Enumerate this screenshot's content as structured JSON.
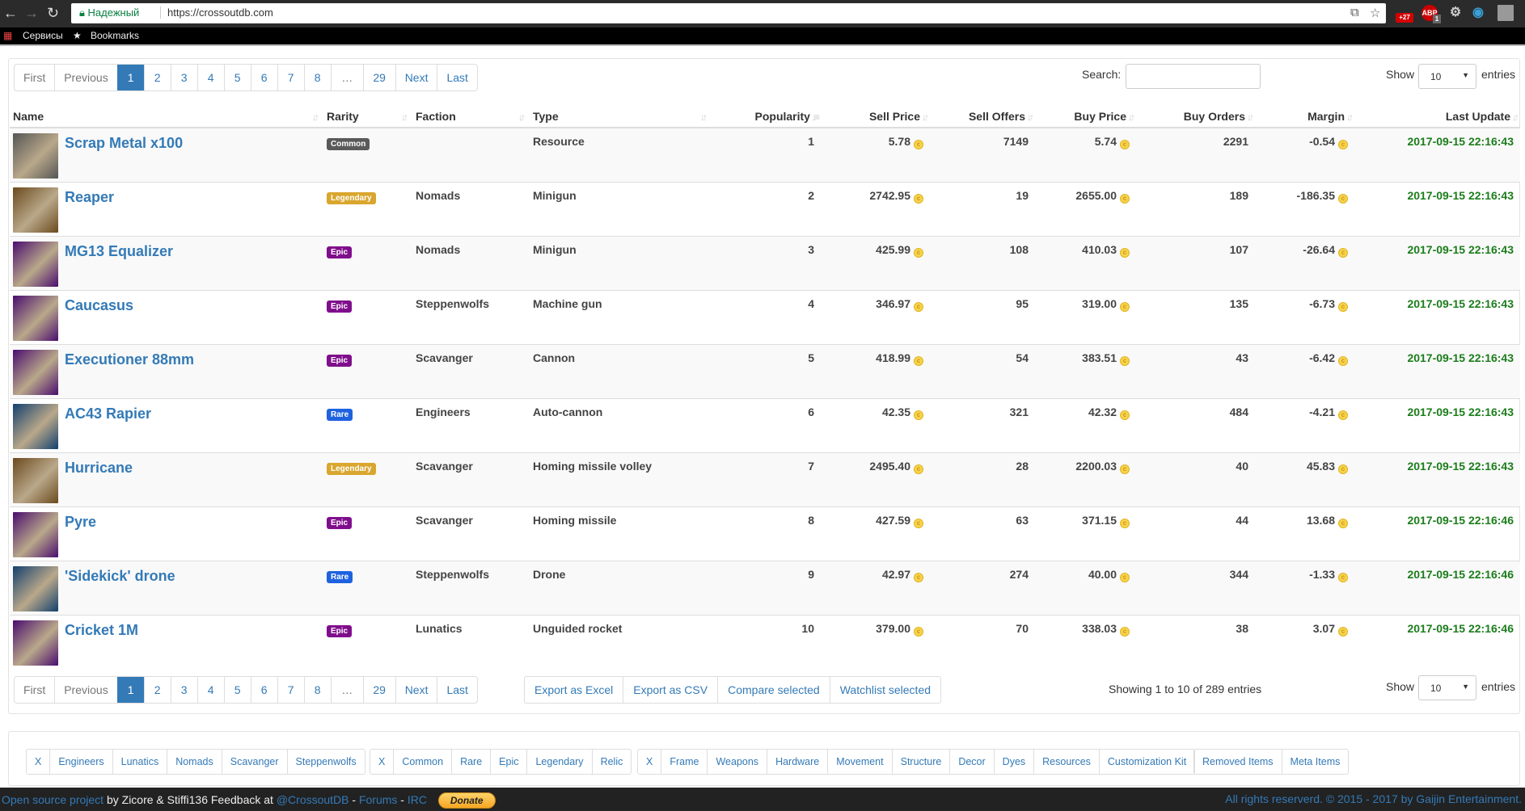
{
  "browser": {
    "secure_label": "Надежный",
    "url": "https://crossoutdb.com",
    "ext_badge": "+27",
    "abp_label": "ABP",
    "abp_count": "1",
    "bookmarks": [
      {
        "label": "Сервисы"
      },
      {
        "label": "Bookmarks"
      }
    ]
  },
  "pagination": {
    "first": "First",
    "previous": "Previous",
    "pages": [
      "1",
      "2",
      "3",
      "4",
      "5",
      "6",
      "7",
      "8",
      "…",
      "29"
    ],
    "next": "Next",
    "last": "Last",
    "current": "1"
  },
  "search": {
    "label": "Search:",
    "value": ""
  },
  "length": {
    "show": "Show",
    "value": "10",
    "entries": "entries"
  },
  "table": {
    "columns": [
      "Name",
      "Rarity",
      "Faction",
      "Type",
      "Popularity",
      "Sell Price",
      "Sell Offers",
      "Buy Price",
      "Buy Orders",
      "Margin",
      "Last Update"
    ],
    "rows": [
      {
        "name": "Scrap Metal x100",
        "rarity": "Common",
        "faction": "",
        "type": "Resource",
        "popularity": "1",
        "sell_price": "5.78",
        "sell_offers": "7149",
        "buy_price": "5.74",
        "buy_orders": "2291",
        "margin": "-0.54",
        "updated": "2017-09-15 22:16:43"
      },
      {
        "name": "Reaper",
        "rarity": "Legendary",
        "faction": "Nomads",
        "type": "Minigun",
        "popularity": "2",
        "sell_price": "2742.95",
        "sell_offers": "19",
        "buy_price": "2655.00",
        "buy_orders": "189",
        "margin": "-186.35",
        "updated": "2017-09-15 22:16:43"
      },
      {
        "name": "MG13 Equalizer",
        "rarity": "Epic",
        "faction": "Nomads",
        "type": "Minigun",
        "popularity": "3",
        "sell_price": "425.99",
        "sell_offers": "108",
        "buy_price": "410.03",
        "buy_orders": "107",
        "margin": "-26.64",
        "updated": "2017-09-15 22:16:43"
      },
      {
        "name": "Caucasus",
        "rarity": "Epic",
        "faction": "Steppenwolfs",
        "type": "Machine gun",
        "popularity": "4",
        "sell_price": "346.97",
        "sell_offers": "95",
        "buy_price": "319.00",
        "buy_orders": "135",
        "margin": "-6.73",
        "updated": "2017-09-15 22:16:43"
      },
      {
        "name": "Executioner 88mm",
        "rarity": "Epic",
        "faction": "Scavanger",
        "type": "Cannon",
        "popularity": "5",
        "sell_price": "418.99",
        "sell_offers": "54",
        "buy_price": "383.51",
        "buy_orders": "43",
        "margin": "-6.42",
        "updated": "2017-09-15 22:16:43"
      },
      {
        "name": "AC43 Rapier",
        "rarity": "Rare",
        "faction": "Engineers",
        "type": "Auto-cannon",
        "popularity": "6",
        "sell_price": "42.35",
        "sell_offers": "321",
        "buy_price": "42.32",
        "buy_orders": "484",
        "margin": "-4.21",
        "updated": "2017-09-15 22:16:43"
      },
      {
        "name": "Hurricane",
        "rarity": "Legendary",
        "faction": "Scavanger",
        "type": "Homing missile volley",
        "popularity": "7",
        "sell_price": "2495.40",
        "sell_offers": "28",
        "buy_price": "2200.03",
        "buy_orders": "40",
        "margin": "45.83",
        "updated": "2017-09-15 22:16:43"
      },
      {
        "name": "Pyre",
        "rarity": "Epic",
        "faction": "Scavanger",
        "type": "Homing missile",
        "popularity": "8",
        "sell_price": "427.59",
        "sell_offers": "63",
        "buy_price": "371.15",
        "buy_orders": "44",
        "margin": "13.68",
        "updated": "2017-09-15 22:16:46"
      },
      {
        "name": "'Sidekick' drone",
        "rarity": "Rare",
        "faction": "Steppenwolfs",
        "type": "Drone",
        "popularity": "9",
        "sell_price": "42.97",
        "sell_offers": "274",
        "buy_price": "40.00",
        "buy_orders": "344",
        "margin": "-1.33",
        "updated": "2017-09-15 22:16:46"
      },
      {
        "name": "Cricket 1M",
        "rarity": "Epic",
        "faction": "Lunatics",
        "type": "Unguided rocket",
        "popularity": "10",
        "sell_price": "379.00",
        "sell_offers": "70",
        "buy_price": "338.03",
        "buy_orders": "38",
        "margin": "3.07",
        "updated": "2017-09-15 22:16:46"
      }
    ]
  },
  "rarity_colors": {
    "Common": "#5a5a5a",
    "Legendary": "#d9a62e",
    "Epic": "#800e8c",
    "Rare": "#1f62e0"
  },
  "thumb_colors": {
    "Common": "#555555",
    "Legendary": "#6b4a1e",
    "Epic": "#4a0d6e",
    "Rare": "#12406e"
  },
  "exports": [
    "Export as Excel",
    "Export as CSV",
    "Compare selected",
    "Watchlist selected"
  ],
  "showing": "Showing 1 to 10 of 289 entries",
  "filters": [
    [
      "X",
      "Engineers",
      "Lunatics",
      "Nomads",
      "Scavanger",
      "Steppenwolfs"
    ],
    [
      "X",
      "Common",
      "Rare",
      "Epic",
      "Legendary",
      "Relic"
    ],
    [
      "X",
      "Frame",
      "Weapons",
      "Hardware",
      "Movement",
      "Structure",
      "Decor",
      "Dyes",
      "Resources",
      "Customization Kit"
    ],
    [
      "Removed Items",
      "Meta Items"
    ]
  ],
  "footer": {
    "open_source": "Open source project",
    "by": " by Zicore & Stiffi136 Feedback at ",
    "twitter": "@CrossoutDB",
    "sep1": " - ",
    "forums": "Forums",
    "sep2": " - ",
    "irc": "IRC",
    "donate": "Donate",
    "rights": "All rights reserverd. © 2015 - 2017 by Gaijin Entertainment."
  }
}
